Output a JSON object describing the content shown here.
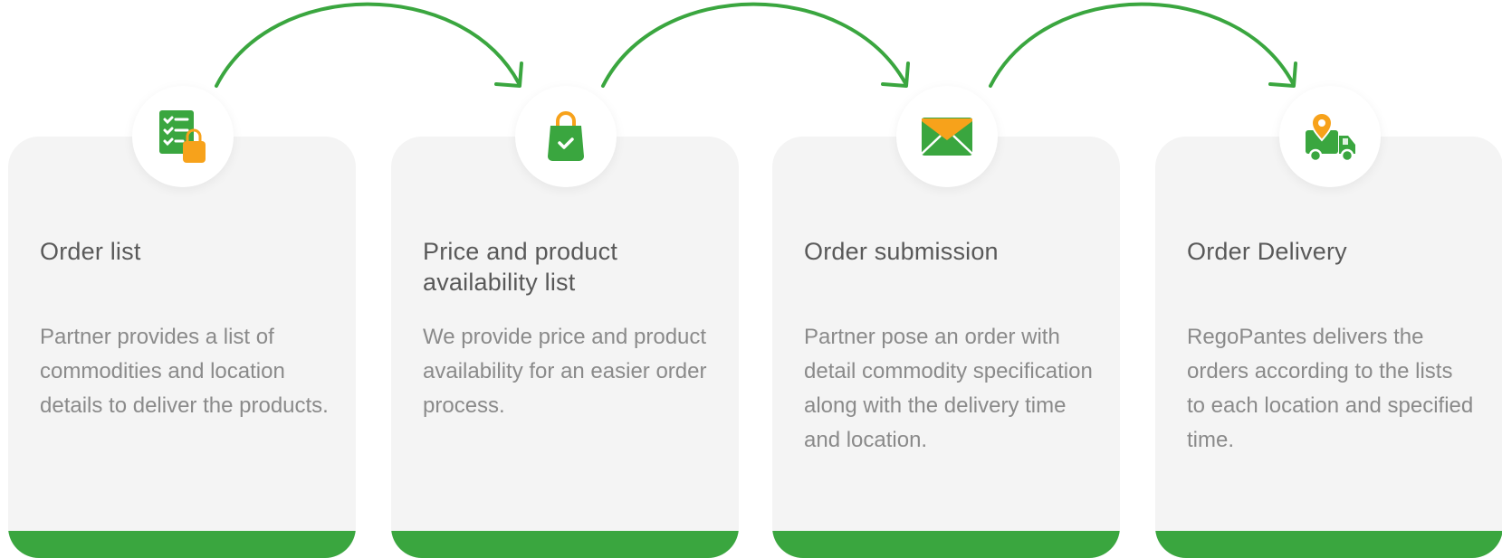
{
  "colors": {
    "accent": "#3aa63f",
    "icon_orange": "#f7a21b",
    "card_bg": "#f4f4f4",
    "title": "#595959",
    "text": "#8a8a8a"
  },
  "steps": [
    {
      "icon": "checklist-bag-icon",
      "title": "Order list",
      "description": "Partner provides a list of commodities and location details to deliver the products."
    },
    {
      "icon": "shopping-bag-icon",
      "title": "Price and product availability list",
      "description": "We provide price and product availability for an easier order process."
    },
    {
      "icon": "envelope-icon",
      "title": "Order submission",
      "description": "Partner pose an order with detail commodity specification along with the delivery time and location."
    },
    {
      "icon": "delivery-truck-icon",
      "title": "Order Delivery",
      "description": "RegoPantes delivers the orders according to the lists to each location and specified time."
    }
  ]
}
